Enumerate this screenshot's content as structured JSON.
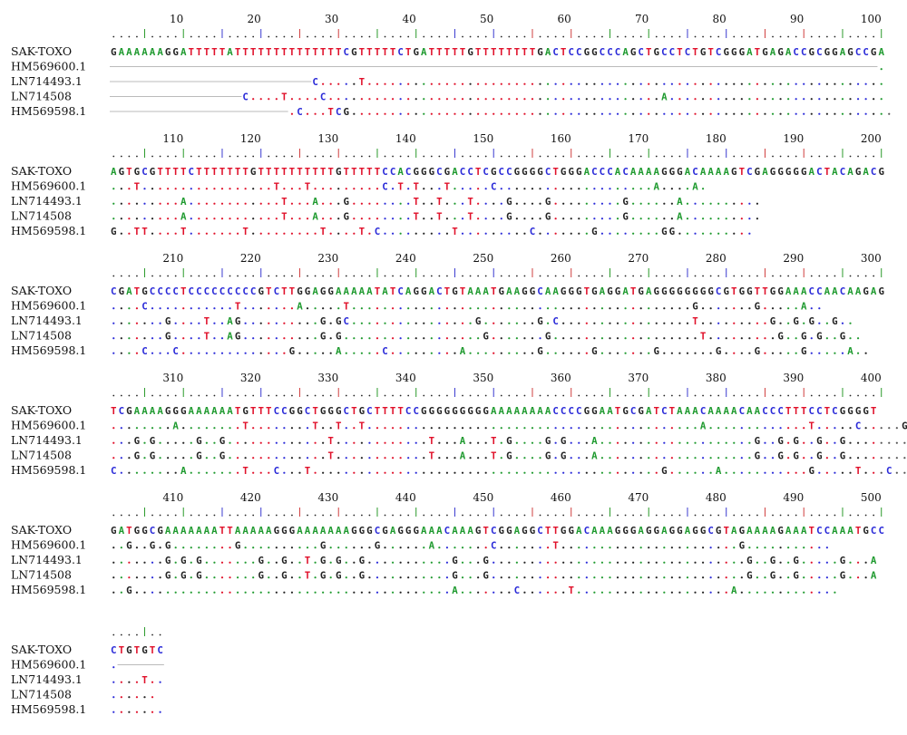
{
  "colors": {
    "A": "#1f9a2f",
    "C": "#2a2ad8",
    "G": "#222222",
    "T": "#e0102a",
    "dot_default": "#555555",
    "ruler_tick_a": "#2a9a2a",
    "ruler_tick_b": "#3a3ad0",
    "ruler_tick_c": "#d04040"
  },
  "sequence_names": [
    "SAK-TOXO",
    "HM569600.1",
    "LN714493.1",
    "LN714508",
    "HM569598.1"
  ],
  "blocks": [
    {
      "start": 1,
      "ticks": [
        "10",
        "20",
        "30",
        "40",
        "50",
        "60",
        "70",
        "80",
        "90",
        "100"
      ],
      "ruler": "....|....|....|....|....|....|....|....|....|....|....|....|....|....|....|....|....|....|....|....|",
      "rows": [
        "GAAAAAAGGATTTTTATTTTTTTTTTTTTTCGTTTTTCTGATTTTTGTTTTTTTTGACTCCGGCCCAGCTGCCTCTGTCGGGATGAGACCGCGGAGCCGA",
        "---------------------------------------------------------------------------------------------------.",
        "--------------------------C.....T...................................................................",
        "-----------------C....T....C...........................................A............................",
        "-----------------------.C...TCG......................................................................"
      ]
    },
    {
      "start": 101,
      "ticks": [
        "110",
        "120",
        "130",
        "140",
        "150",
        "160",
        "170",
        "180",
        "190",
        "200"
      ],
      "ruler": "....|....|....|....|....|....|....|....|....|....|....|....|....|....|....|....|....|....|....|....|",
      "rows": [
        "AGTGCGTTTTCTTTTTTTGTTTTTTTTTTGTTTTTCCACGGGCGACCTCGCCGGGGCTGGGACCCACAAAAGGGACAAAAGTCGAGGGGGACTACAGACG",
        "...T.................T...T.........C.T.T...T.....C....................A....A.",
        ".........A............T...A...G........T..T...T....G....G.........G......A..........",
        ".........A............T...A...G........T..T...T....G....G.........G......A..........",
        "G..TT....T.......T.........T....T.C.........T.........C.......G........GG.........."
      ]
    },
    {
      "start": 201,
      "ticks": [
        "210",
        "220",
        "230",
        "240",
        "250",
        "260",
        "270",
        "280",
        "290",
        "300"
      ],
      "ruler": "....|....|....|....|....|....|....|....|....|....|....|....|....|....|....|....|....|....|....|....|",
      "rows": [
        "CGATGCCCCTCCCCCCCCCGTCTTGGAGGAAAAATATCAGGACTGTAAATGAAGGCAAGGGTGAGGATGAGGGGGGGGCGTGGTTGGAAACCAACAAGAG",
        "....C...........T.......A.....T............................................G.......G.....A..",
        ".......G....T..AG..........G.GC................G.......G.C.................T.........G..G.G..G..",
        ".......G....T..AG..........G.G..................G.......G...................T.........G..G.G..G..",
        "....C...C..............G.....A.....C.........A.........G......G.......G.......G....G.....G.....A.."
      ]
    },
    {
      "start": 301,
      "ticks": [
        "310",
        "320",
        "330",
        "340",
        "350",
        "360",
        "370",
        "380",
        "390",
        "400"
      ],
      "ruler": "....|....|....|....|....|....|....|....|....|....|....|....|....|....|....|....|....|....|....|....|",
      "rows": [
        "TCGAAAAGGGAAAAAATGTTTCCGGCTGGGCTGCTTTTCCGGGGGGGGGAAAAAAAACCCCGGAATGCGATCTAAACAAAACAACCCTTTCCTCGGGGT",
        "........A........T........T..T..T...........................................A.............T.....C.....G",
        "...G.G.....G..G.............T............T...A...T.G....G.G...A....................G..G.G..G..G.........T...",
        "...G.G.....G..G.............T............T...A...T.G....G.G...A....................G..G.G..G..G.........T...",
        "C........A.......T...C...T.............................................G......A...........G.....T...C.........G"
      ]
    },
    {
      "start": 401,
      "ticks": [
        "410",
        "420",
        "430",
        "440",
        "450",
        "460",
        "470",
        "480",
        "490",
        "500"
      ],
      "ruler": "....|....|....|....|....|....|....|....|....|....|....|....|....|....|....|....|....|....|....|....|",
      "rows": [
        "GATGGCGAAAAAAATTAAAAAGGGAAAAAAAGGGCGAGGGAAACAAAGTCGGAGGCTTGGACAAAGGGAGGAGGAGGCGTAGAAAAGAAATCCAAATGCC",
        "..G..G.G........G..........G......G......A.......C.......T.......................G...........",
        ".......G.G.G.......G..G..T.G.G..G...........G...G.................................G..G..G.....G...A",
        ".......G.G.G.......G..G..T.G.G..G...........G...G.................................G..G..G.....G...A",
        "..G.........................................A.......C......T....................A............."
      ]
    },
    {
      "start": 501,
      "ticks": [],
      "ruler": "....|..",
      "rows": [
        "CTGTGTC",
        ".------",
        "....T..",
        "......",
        "......."
      ]
    }
  ]
}
